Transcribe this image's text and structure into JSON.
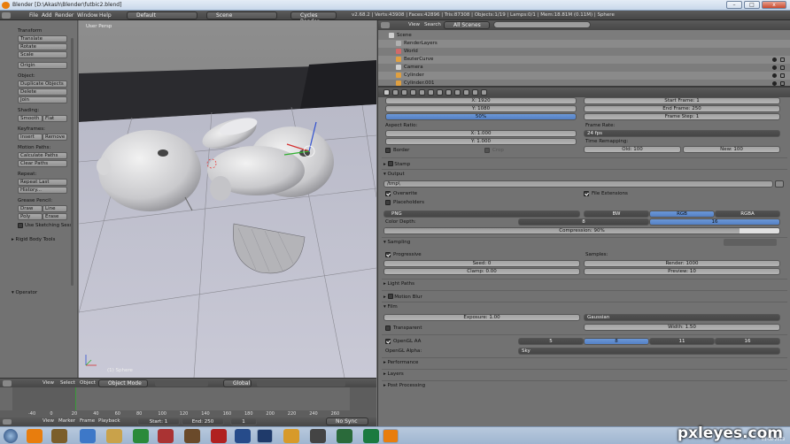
{
  "window": {
    "title": "Blender [D:\\Akash\\Blender\\futbic2.blend]",
    "min": "–",
    "max": "□",
    "close": "x"
  },
  "infobar": {
    "menus": [
      "File",
      "Add",
      "Render",
      "Window",
      "Help"
    ],
    "layout": "Default",
    "scene": "Scene",
    "engine": "Cycles Render",
    "stats": "v2.68.2 | Verts:43908 | Faces:42896 | Tris:87308 | Objects:1/19 | Lamps:0/1 | Mem:18.81M (0.11M) | Sphere"
  },
  "toolshelf": {
    "transform": {
      "title": "Transform",
      "buttons": [
        "Translate",
        "Rotate",
        "Scale"
      ],
      "origin": "Origin"
    },
    "object": {
      "title": "Object:",
      "buttons": [
        "Duplicate Objects",
        "Delete",
        "Join"
      ]
    },
    "shading": {
      "title": "Shading:",
      "smooth": "Smooth",
      "flat": "Flat"
    },
    "keyframes": {
      "title": "Keyframes:",
      "insert": "Insert",
      "remove": "Remove"
    },
    "motion": {
      "title": "Motion Paths:",
      "buttons": [
        "Calculate Paths",
        "Clear Paths"
      ]
    },
    "repeat": {
      "title": "Repeat:",
      "buttons": [
        "Repeat Last",
        "History..."
      ]
    },
    "grease": {
      "title": "Grease Pencil:",
      "draw": "Draw",
      "line": "Line",
      "poly": "Poly",
      "erase": "Erase",
      "sketch": "Use Sketching Sess"
    },
    "rigid": "Rigid Body Tools",
    "operator": "Operator"
  },
  "viewport": {
    "label": "User Persp",
    "object": "(1) Sphere"
  },
  "viewport_header": {
    "view": "View",
    "select": "Select",
    "object": "Object",
    "mode": "Object Mode",
    "orient": "Global"
  },
  "timeline": {
    "ticks": [
      "-40",
      "0",
      "20",
      "40",
      "60",
      "80",
      "100",
      "120",
      "140",
      "160",
      "180",
      "200",
      "220",
      "240",
      "260"
    ],
    "view": "View",
    "marker": "Marker",
    "frame": "Frame",
    "playback": "Playback",
    "start": "Start: 1",
    "end": "End: 250",
    "current": "1",
    "sync": "No Sync"
  },
  "outliner": {
    "view": "View",
    "search": "Search",
    "filter": "All Scenes",
    "items": [
      {
        "label": "Scene",
        "color": "#cfcfcf"
      },
      {
        "label": "RenderLayers",
        "color": "#b0b0b0"
      },
      {
        "label": "World",
        "color": "#d06a6a"
      },
      {
        "label": "BezierCurve",
        "color": "#e0a040"
      },
      {
        "label": "Camera",
        "color": "#d0d0d0"
      },
      {
        "label": "Cylinder",
        "color": "#e0a040"
      },
      {
        "label": "Cylinder.001",
        "color": "#e0a040"
      }
    ]
  },
  "props": {
    "res_x": "X: 1920",
    "res_y": "Y: 1080",
    "res_pct": "50%",
    "start_frame": "Start Frame: 1",
    "end_frame": "End Frame: 250",
    "frame_step": "Frame Step: 1",
    "aspect": "Aspect Ratio:",
    "aspect_x": "X: 1.000",
    "aspect_y": "Y: 1.000",
    "frame_rate": "Frame Rate:",
    "fps": "24 fps",
    "remap": "Time Remapping:",
    "old": "Old: 100",
    "new": "New: 100",
    "border": "Border",
    "crop": "Crop",
    "stamp": "Stamp",
    "output": "Output",
    "path": "/tmp\\",
    "overwrite": "Overwrite",
    "file_ext": "File Extensions",
    "placeholders": "Placeholders",
    "format": "PNG",
    "bw": "BW",
    "rgb": "RGB",
    "rgba": "RGBA",
    "color_depth": "Color Depth:",
    "depth8": "8",
    "depth16": "16",
    "compression": "Compression: 90%",
    "compression_fraction": 0.9,
    "sampling": "Sampling",
    "progressive": "Progressive",
    "samples": "Samples:",
    "seed": "Seed: 0",
    "clamp": "Clamp: 0.00",
    "render": "Render: 1000",
    "preview": "Preview: 10",
    "light_paths": "Light Paths",
    "motion_blur": "Motion Blur",
    "film": "Film",
    "exposure": "Exposure: 1.00",
    "filter": "Gaussian",
    "transparent": "Transparent",
    "width": "Width: 1.50",
    "opengl_aa": "OpenGL AA",
    "aa5": "5",
    "aa8": "8",
    "aa11": "11",
    "aa16": "16",
    "opengl_alpha": "OpenGL Alpha:",
    "sky": "Sky",
    "performance": "Performance",
    "layers": "Layers",
    "post": "Post Processing"
  },
  "taskbar": {
    "start_time": "01-08-2013"
  },
  "watermark": "pxleyes.com"
}
